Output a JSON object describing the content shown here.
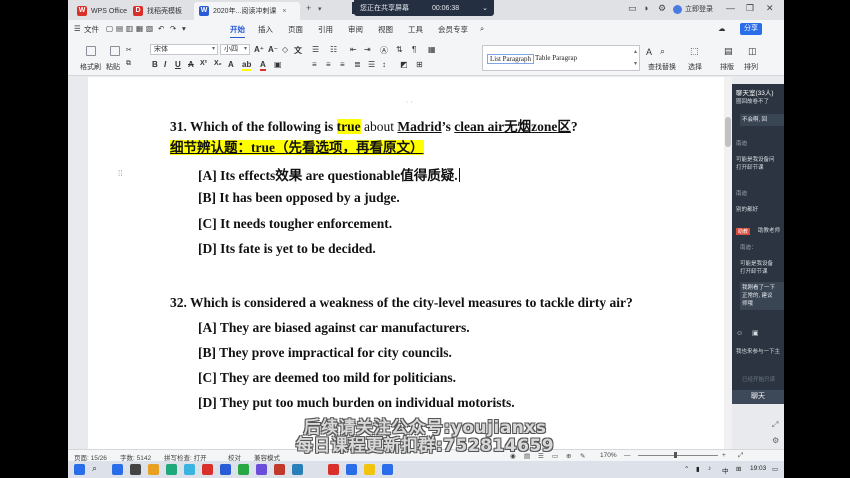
{
  "titlebar": {
    "tabs": [
      {
        "label": "WPS Office",
        "color": "#d9302c"
      },
      {
        "label": "找稻壳模板",
        "color": "#d9302c"
      },
      {
        "label": "2020年...阅读冲刺课",
        "color": "#2a5bd7"
      }
    ],
    "add_tab": "+",
    "sharing_status": "您正在共享屏幕",
    "sharing_timer": "00:06:38",
    "login": "立即登录"
  },
  "menubar": {
    "file": "文件",
    "items": [
      "开始",
      "插入",
      "页面",
      "引用",
      "审阅",
      "视图",
      "工具",
      "会员专享"
    ],
    "share": "分享"
  },
  "ribbon": {
    "format_painter": "格式刷",
    "paste": "粘贴",
    "font_family": "宋体",
    "font_size": "小四",
    "styles": [
      "List Paragraph",
      "Table Paragrap"
    ],
    "find_replace": "查找替换",
    "select": "选择",
    "sort": "排版",
    "arrange": "排列"
  },
  "document": {
    "q31": {
      "number": "31.",
      "pre": "Which of the following is",
      "highlight": "true",
      "mid": "about",
      "madrid": "Madrid",
      "apos": "’s",
      "clean_air": "clean air",
      "zone_cn1": "无烟",
      "zone": "zone",
      "zone_cn2": "区",
      "end": "?",
      "note": "细节辨认题：true（先看选项，再看原文）"
    },
    "q31_options": [
      "[A] Its effects效果 are questionable值得质疑.",
      "[B] It has been opposed by a judge.",
      "[C] It needs tougher enforcement.",
      "[D] Its fate is yet to be decided."
    ],
    "q32": "32. Which is considered a weakness of the city-level measures to tackle dirty air?",
    "q32_options": [
      "[A] They are biased against car manufacturers.",
      "[B] They prove impractical for city councils.",
      "[C] They are deemed too mild for politicians.",
      "[D] They put too much burden on individual motorists."
    ]
  },
  "chat": {
    "title": "聊天室(33人)",
    "messages": [
      {
        "name": "",
        "text": "圈回故卷不了"
      },
      {
        "name": "",
        "text": "不会啊, 回"
      },
      {
        "name": "南迪",
        "text": "可能是我设备问"
      },
      {
        "name": "",
        "text": "打开卸节课"
      },
      {
        "name": "南迪",
        "text": "别的都好"
      },
      {
        "name": "",
        "text": "助教老师"
      },
      {
        "name": "南迪：",
        "text": "可能是我设备"
      },
      {
        "name": "",
        "text": "打开卸节课"
      },
      {
        "name": "",
        "text": "我刚看了一下"
      },
      {
        "name": "",
        "text": "正常的, 建议"
      },
      {
        "name": "",
        "text": "师哦"
      }
    ],
    "badge": "助教",
    "input_hint": "我也来参与一下主",
    "input_sub": "已经开始只读",
    "footer": "聊天"
  },
  "statusbar": {
    "page": "页面: 15/26",
    "words": "字数: 5142",
    "spell": "拼写检查: 打开",
    "proof": "校对",
    "compat": "兼容模式",
    "zoom": "170%"
  },
  "taskbar": {
    "time": "19:03",
    "ime": "中"
  },
  "watermark": {
    "line1": "后续请关注公众号:youjianxs",
    "line2": "每日课程更新扣群:752814659"
  }
}
